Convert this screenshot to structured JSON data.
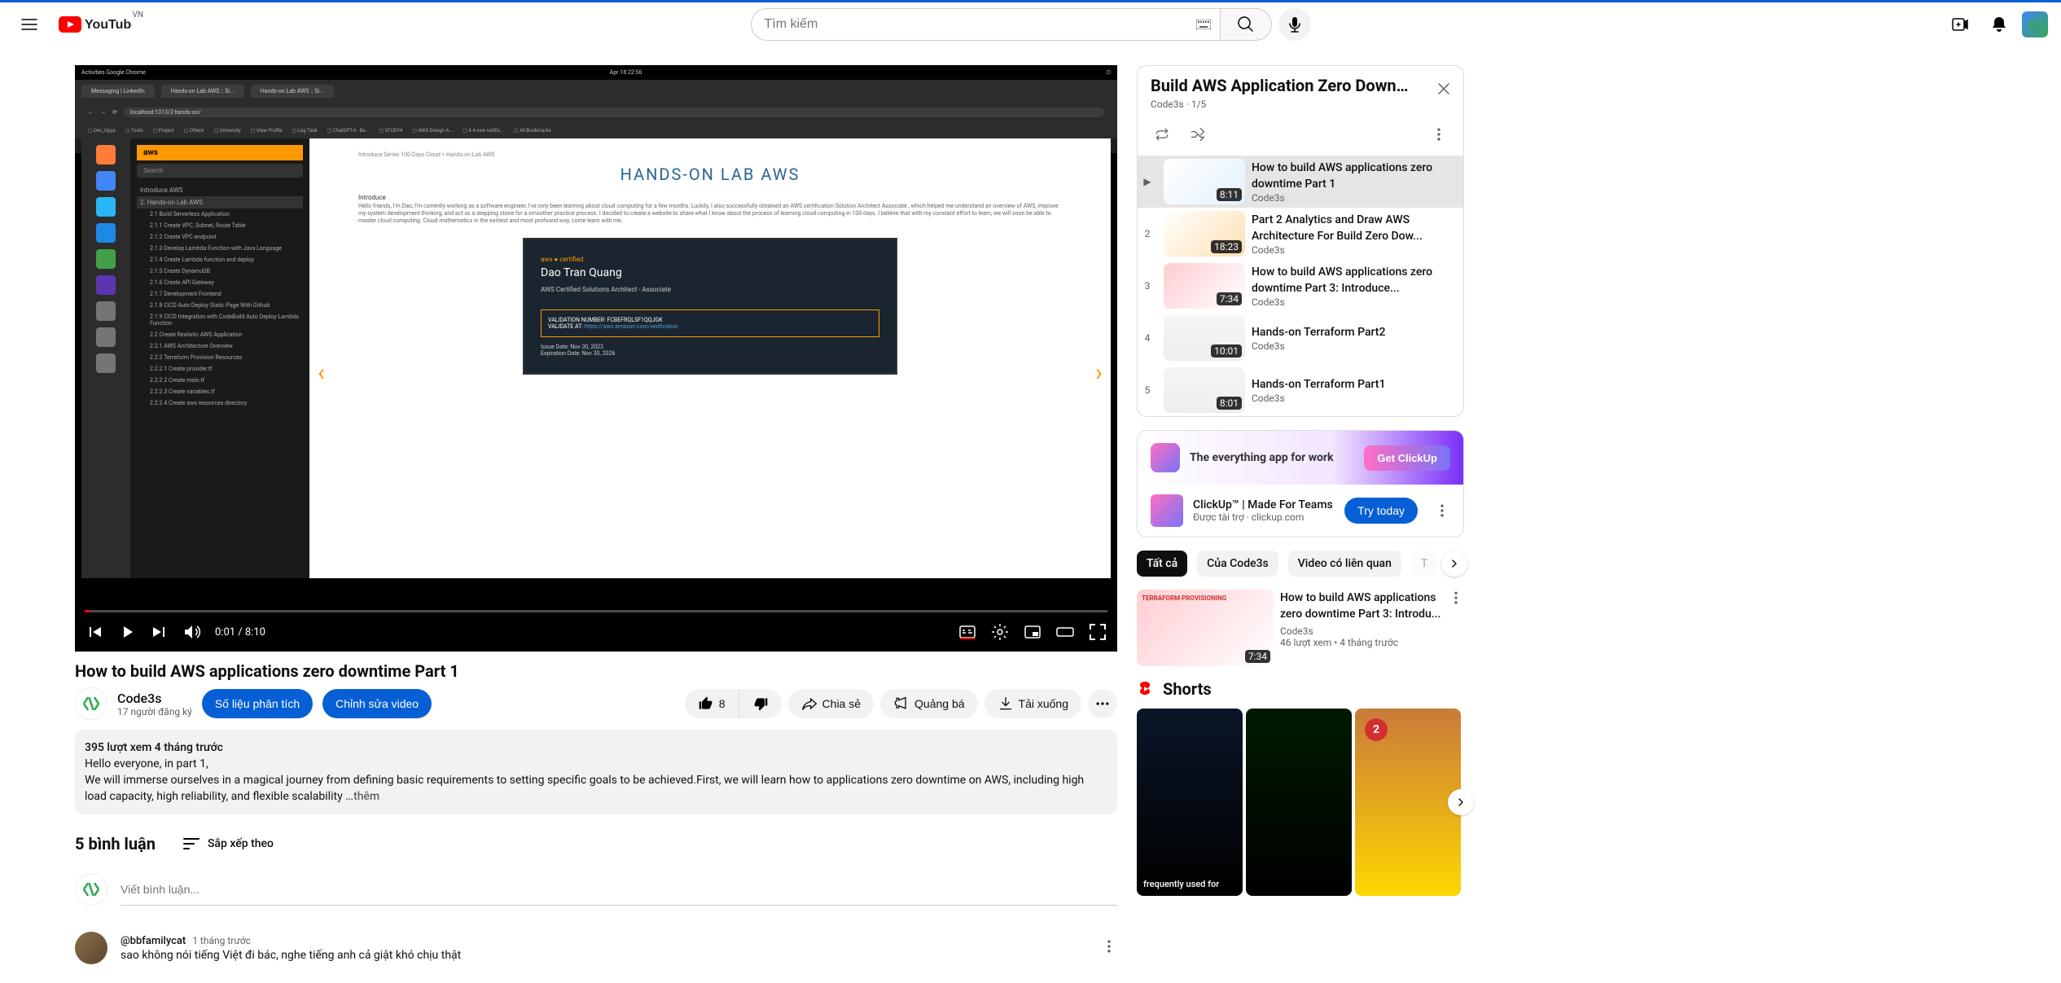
{
  "header": {
    "country": "VN",
    "search_placeholder": "Tìm kiếm"
  },
  "player": {
    "time": "0:01 / 8:10",
    "statusbar_left": "Activities   Google Chrome",
    "statusbar_center": "Apr 18  22:56",
    "tab1": "Messaging | LinkedIn",
    "tab2": "Hands-on Lab AWS :: Si...",
    "tab3": "Hands-on Lab AWS :: Si...",
    "url": "localhost:1313/2-hands-on/",
    "bookmarks": [
      "Dev_Opps",
      "Tools",
      "Project",
      "Others",
      "University",
      "View Profile",
      "Log Task",
      "ChatGPT-4 - Be...",
      "STUDY4",
      "AWS Design A...",
      "4 4 new notific...",
      "All Bookmarks"
    ],
    "nav_search": "Search",
    "nav_top": "Introduce AWS",
    "nav_section": "2. Hands-on Lab AWS",
    "nav_items": [
      "2.1 Build Serverless Application",
      "2.1.1 Create VPC, Subnet, Route Table",
      "2.1.2 Create VPC endpoint",
      "2.1.3 Develop Lambda Function with Java Language",
      "2.1.4 Create Lambda function and deploy",
      "2.1.5 Create DynamoDB",
      "2.1.6 Create API Gateway",
      "2.1.7 Development Frontend",
      "2.1.8 CICD Auto Deploy Static Page With Github",
      "2.1.9 CICD Integration with CodeBuild Auto Deploy Lambda Function",
      "2.2 Create Realistic AWS Application",
      "2.2.1 AWS Architecture Overview",
      "2.2.2 Terraform Provision Resources",
      "2.2.2.1 Create provider.tf",
      "2.2.2.2 Create main.tf",
      "2.2.2.3 Create variables.tf",
      "2.2.2.4 Create aws resources directory"
    ],
    "breadcrumb": "Introduce Series 100 Days Cloud > Hands-on Lab AWS",
    "main_title": "HANDS-ON LAB AWS",
    "intro_label": "Introduce",
    "intro_text": "Hello friends, I'm Dao, I'm currently working as a software engineer, I've only been learning about cloud computing for a few months. Luckily, I also successfully obtained an AWS certification Solution Architect Associate , which helped me understand an overview of AWS, improve my system development thinking, and act as a stepping stone for a smoother practice process. I decided to create a website to share what I know about the process of learning cloud computing in 100 days. I believe that with my constant effort to learn, we will soon be able to master cloud computing. Cloud mathematics in the earliest and most profound way, come learn with me.",
    "cert_badge": "aws ● certified",
    "cert_name": "Dao Tran Quang",
    "cert_role": "AWS Certified Solutions Architect - Associate",
    "cert_validation_label": "VALIDATION NUMBER:",
    "cert_validation": "FCBEFRQLSF1QQJGK",
    "cert_validate_at_label": "VALIDATE AT:",
    "cert_validate_url": "https://aws.amazon.com/verification",
    "cert_issue": "Issue Date:    Nov 30, 2023",
    "cert_expire": "Expiration Date:   Nov 30, 2026"
  },
  "video": {
    "title": "How to build AWS applications zero downtime Part 1",
    "channel": "Code3s",
    "subs": "17 người đăng ký",
    "analytics_btn": "Số liệu phân tích",
    "edit_btn": "Chỉnh sửa video",
    "likes": "8",
    "share": "Chia sẻ",
    "promote": "Quảng bá",
    "download": "Tải xuống"
  },
  "description": {
    "header": "395 lượt xem  4 tháng trước",
    "line1": "Hello everyone, in part 1,",
    "line2": "We will immerse ourselves in a magical journey from defining basic requirements to setting specific goals to be achieved.First, we will learn how to applications zero downtime on AWS, including high load capacity, high reliability, and flexible scalability   ",
    "more": "…thêm"
  },
  "comments": {
    "count": "5 bình luận",
    "sort": "Sắp xếp theo",
    "placeholder": "Viết bình luận...",
    "c1_author": "@bbfamilycat",
    "c1_time": "1 tháng trước",
    "c1_text": "sao không nói tiếng Việt đi bác, nghe tiếng anh cả giật khó chịu thật"
  },
  "playlist": {
    "title": "Build AWS Application Zero DownTi...",
    "channel": "Code3s",
    "progress": "1/5",
    "items": [
      {
        "index": "▶",
        "title": "How to build AWS applications zero downtime Part 1",
        "channel": "Code3s",
        "duration": "8:11"
      },
      {
        "index": "2",
        "title": "Part 2 Analytics and Draw AWS Architecture For Build Zero Dow...",
        "channel": "Code3s",
        "duration": "18:23"
      },
      {
        "index": "3",
        "title": "How to build AWS applications zero downtime Part 3: Introduce...",
        "channel": "Code3s",
        "duration": "7:34"
      },
      {
        "index": "4",
        "title": "Hands-on Terraform Part2",
        "channel": "Code3s",
        "duration": "10:01"
      },
      {
        "index": "5",
        "title": "Hands-on Terraform Part1",
        "channel": "Code3s",
        "duration": "8:01"
      }
    ]
  },
  "ad": {
    "banner_text": "The everything app for work",
    "banner_btn": "Get ClickUp",
    "title": "ClickUp™ | Made For Teams",
    "sponsored": "Được tài trợ",
    "domain": "clickup.com",
    "try_btn": "Try today"
  },
  "chips": [
    "Tất cả",
    "Của Code3s",
    "Video có liên quan",
    "T"
  ],
  "related": {
    "title": "How to build AWS applications zero downtime Part 3: Introdu...",
    "channel": "Code3s",
    "meta": "46 lượt xem  •  4 tháng trước",
    "duration": "7:34"
  },
  "shorts": {
    "heading": "Shorts",
    "item1_title": "frequently used for",
    "badge": "2"
  }
}
